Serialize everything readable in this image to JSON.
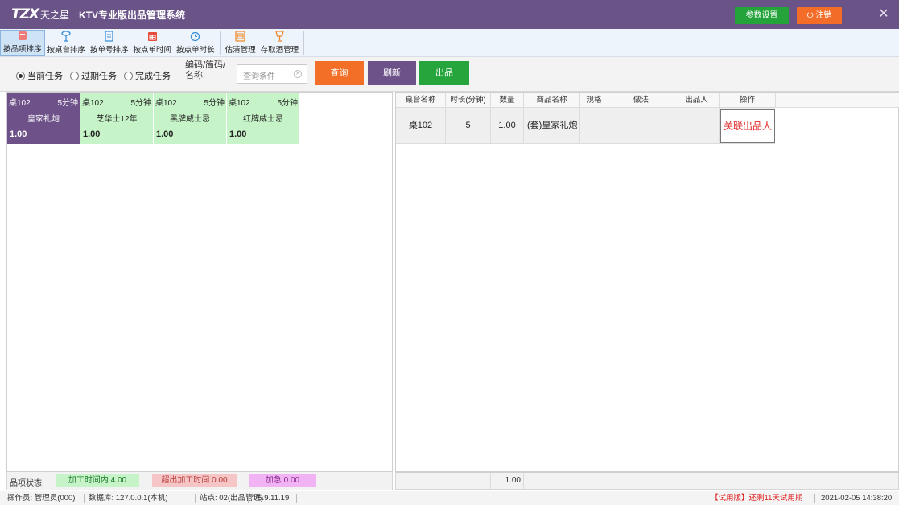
{
  "window": {
    "logo_mark": "TZX",
    "brand": "天之星",
    "title": "KTV专业版出品管理系统",
    "param_button": "参数设置",
    "logout_button": "注销",
    "minimize": "—",
    "close": "✕"
  },
  "colors": {
    "titlebar": "#6a5387",
    "param_green": "#23a33a",
    "logout_orange": "#f36c28",
    "query_orange": "#f36f27",
    "refresh_purple": "#6d5189",
    "output_green": "#25a53b",
    "card_selected": "#6d5188",
    "card_green": "#c6f3c8",
    "link_red": "#e02020"
  },
  "toolbar": {
    "items": [
      {
        "label": "按品项排序",
        "icon": "sort-item-icon",
        "active": true
      },
      {
        "label": "按桌台排序",
        "icon": "table-icon"
      },
      {
        "label": "按单号排序",
        "icon": "order-number-icon"
      },
      {
        "label": "按点单时间",
        "icon": "calendar-icon"
      },
      {
        "label": "按点单时长",
        "icon": "clock-icon"
      },
      {
        "label": "估清管理",
        "icon": "inventory-icon"
      },
      {
        "label": "存取酒管理",
        "icon": "wine-icon"
      }
    ]
  },
  "filter": {
    "radios": [
      {
        "label": "当前任务",
        "checked": true
      },
      {
        "label": "过期任务",
        "checked": false
      },
      {
        "label": "完成任务",
        "checked": false
      }
    ],
    "code_label": "编码/简码/名称:",
    "search_placeholder": "查询条件",
    "query": "查询",
    "refresh": "刷新",
    "output": "出品"
  },
  "cards": [
    {
      "table": "桌102",
      "duration": "5分钟",
      "name": "皇家礼炮",
      "qty": "1.00",
      "selected": true
    },
    {
      "table": "桌102",
      "duration": "5分钟",
      "name": "芝华士12年",
      "qty": "1.00"
    },
    {
      "table": "桌102",
      "duration": "5分钟",
      "name": "黑牌威士忌",
      "qty": "1.00"
    },
    {
      "table": "桌102",
      "duration": "5分钟",
      "name": "红牌威士忌",
      "qty": "1.00"
    }
  ],
  "item_status": {
    "label": "品项状态:",
    "in_time": "加工时间内  4.00",
    "overtime": "超出加工时间  0.00",
    "urgent": "加急  0.00"
  },
  "grid": {
    "headers": [
      "桌台名称",
      "时长(分钟)",
      "数量",
      "商品名称",
      "规格",
      "做法",
      "出品人",
      "操作"
    ],
    "rows": [
      {
        "table": "桌102",
        "duration": "5",
        "qty": "1.00",
        "name": "(套)皇家礼炮",
        "spec": "",
        "method": "",
        "producer": "",
        "action": "关联出品人"
      }
    ],
    "total_qty": "1.00"
  },
  "statusbar": {
    "operator": "操作员: 管理员(000)",
    "database": "数据库: 127.0.0.1(本机)",
    "site": "站点: 02(出品管理)",
    "version": "V5.9.11.19",
    "trial": "【试用版】还剩11天试用期",
    "datetime": "2021-02-05 14:38:20"
  }
}
